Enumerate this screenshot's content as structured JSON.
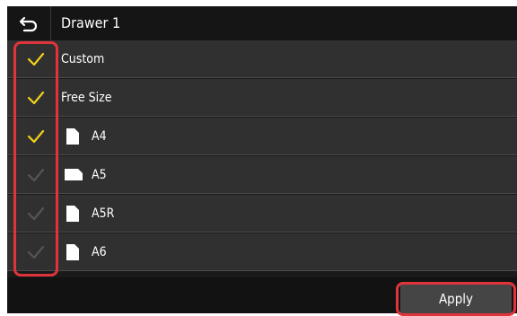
{
  "header": {
    "title": "Drawer 1",
    "back_icon": "back-arrow-icon"
  },
  "items": [
    {
      "label": "Custom",
      "checked": true,
      "icon": null
    },
    {
      "label": "Free Size",
      "checked": true,
      "icon": null
    },
    {
      "label": "A4",
      "checked": true,
      "icon": "portrait-paper-icon"
    },
    {
      "label": "A5",
      "checked": false,
      "icon": "landscape-paper-icon"
    },
    {
      "label": "A5R",
      "checked": false,
      "icon": "portrait-paper-icon"
    },
    {
      "label": "A6",
      "checked": false,
      "icon": "portrait-paper-icon"
    }
  ],
  "footer": {
    "apply_label": "Apply"
  },
  "colors": {
    "check_on": "#f2d21a",
    "check_off": "#555555",
    "highlight": "#e0343c"
  }
}
